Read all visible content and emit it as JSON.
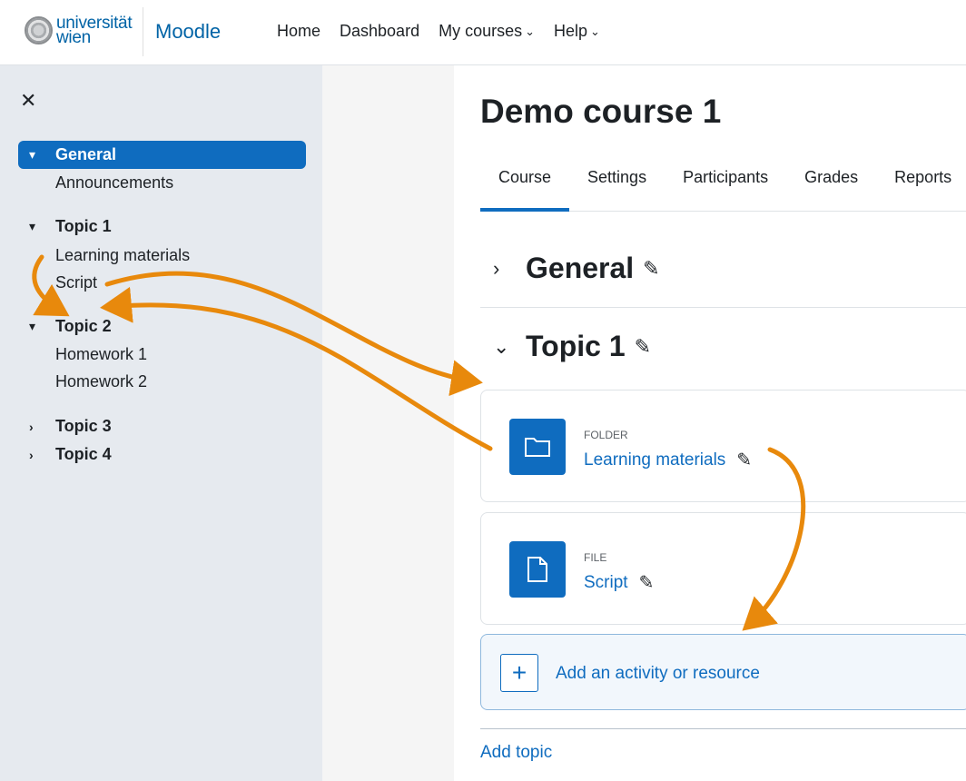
{
  "navbar": {
    "logo_line1": "universität",
    "logo_line2": "wien",
    "brand": "Moodle",
    "links": [
      {
        "label": "Home",
        "dropdown": false
      },
      {
        "label": "Dashboard",
        "dropdown": false
      },
      {
        "label": "My courses",
        "dropdown": true
      },
      {
        "label": "Help",
        "dropdown": true
      }
    ]
  },
  "drawer": {
    "close_icon": "close-icon",
    "sections": [
      {
        "label": "General",
        "expanded": true,
        "active": true,
        "items": [
          "Announcements"
        ]
      },
      {
        "label": "Topic 1",
        "expanded": true,
        "active": false,
        "items": [
          "Learning materials",
          "Script"
        ]
      },
      {
        "label": "Topic 2",
        "expanded": true,
        "active": false,
        "items": [
          "Homework 1",
          "Homework 2"
        ]
      },
      {
        "label": "Topic 3",
        "expanded": false,
        "active": false,
        "items": []
      },
      {
        "label": "Topic 4",
        "expanded": false,
        "active": false,
        "items": []
      }
    ]
  },
  "main": {
    "course_title": "Demo course 1",
    "tabs": [
      {
        "label": "Course",
        "active": true
      },
      {
        "label": "Settings",
        "active": false
      },
      {
        "label": "Participants",
        "active": false
      },
      {
        "label": "Grades",
        "active": false
      },
      {
        "label": "Reports",
        "active": false
      }
    ],
    "sections": [
      {
        "name": "General",
        "expanded": false
      },
      {
        "name": "Topic 1",
        "expanded": true
      }
    ],
    "activities": [
      {
        "type": "FOLDER",
        "name": "Learning materials",
        "icon": "folder-icon"
      },
      {
        "type": "FILE",
        "name": "Script",
        "icon": "file-icon"
      }
    ],
    "add_activity_label": "Add an activity or resource",
    "add_topic_label": "Add topic"
  },
  "colors": {
    "accent": "#0f6cbf",
    "drawer_bg": "#e6eaef",
    "annotation_arrow": "#e8890c"
  }
}
